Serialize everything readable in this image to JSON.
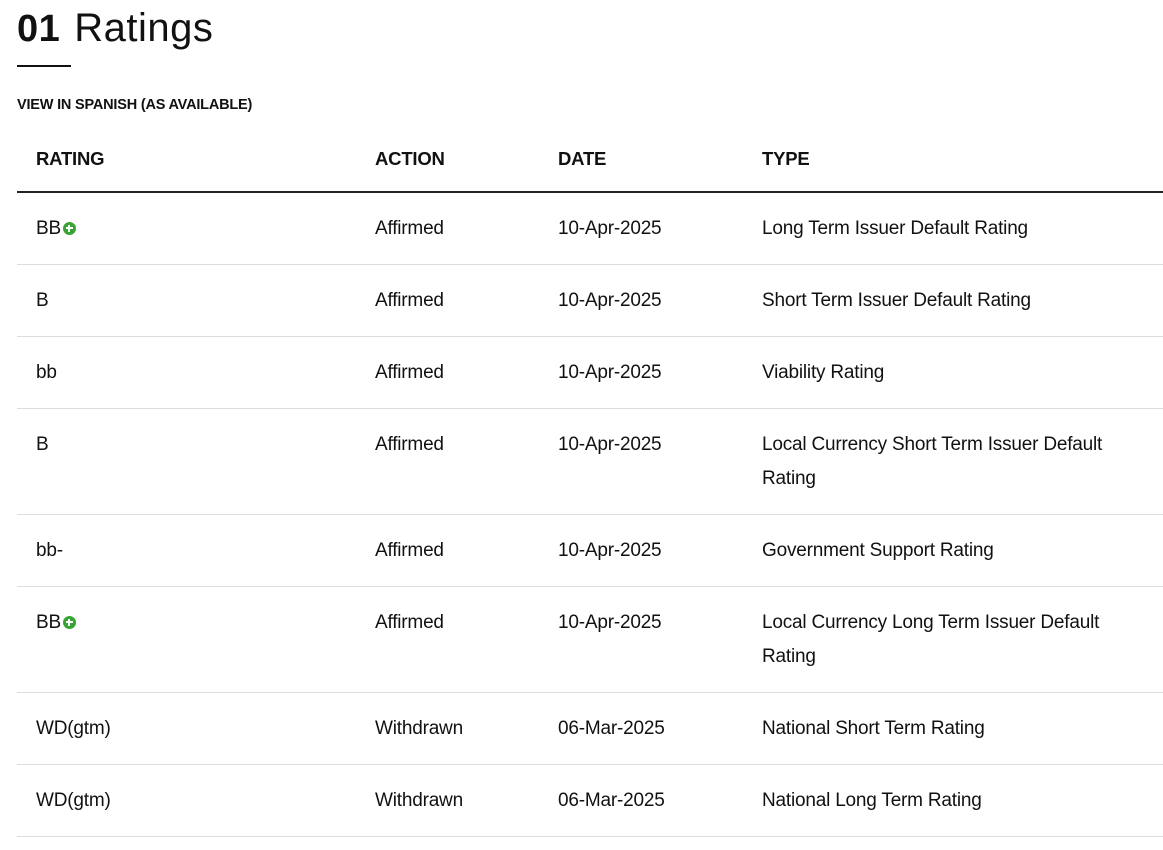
{
  "section": {
    "number": "01",
    "title": "Ratings"
  },
  "spanish_link": "VIEW IN SPANISH (AS AVAILABLE)",
  "table": {
    "headers": {
      "rating": "RATING",
      "action": "ACTION",
      "date": "DATE",
      "type": "TYPE"
    },
    "rows": [
      {
        "rating": "BB",
        "outlook_icon": "positive-outlook-icon",
        "action": "Affirmed",
        "date": "10-Apr-2025",
        "type": "Long Term Issuer Default Rating"
      },
      {
        "rating": "B",
        "outlook_icon": "",
        "action": "Affirmed",
        "date": "10-Apr-2025",
        "type": "Short Term Issuer Default Rating"
      },
      {
        "rating": "bb",
        "outlook_icon": "",
        "action": "Affirmed",
        "date": "10-Apr-2025",
        "type": "Viability Rating"
      },
      {
        "rating": "B",
        "outlook_icon": "",
        "action": "Affirmed",
        "date": "10-Apr-2025",
        "type": "Local Currency Short Term Issuer Default Rating"
      },
      {
        "rating": "bb-",
        "outlook_icon": "",
        "action": "Affirmed",
        "date": "10-Apr-2025",
        "type": "Government Support Rating"
      },
      {
        "rating": "BB",
        "outlook_icon": "positive-outlook-icon",
        "action": "Affirmed",
        "date": "10-Apr-2025",
        "type": "Local Currency Long Term Issuer Default Rating"
      },
      {
        "rating": "WD(gtm)",
        "outlook_icon": "",
        "action": "Withdrawn",
        "date": "06-Mar-2025",
        "type": "National Short Term Rating"
      },
      {
        "rating": "WD(gtm)",
        "outlook_icon": "",
        "action": "Withdrawn",
        "date": "06-Mar-2025",
        "type": "National Long Term Rating"
      }
    ]
  },
  "colors": {
    "positive_outlook": "#3aa335",
    "text": "#111111",
    "row_divider": "#dddddd"
  }
}
